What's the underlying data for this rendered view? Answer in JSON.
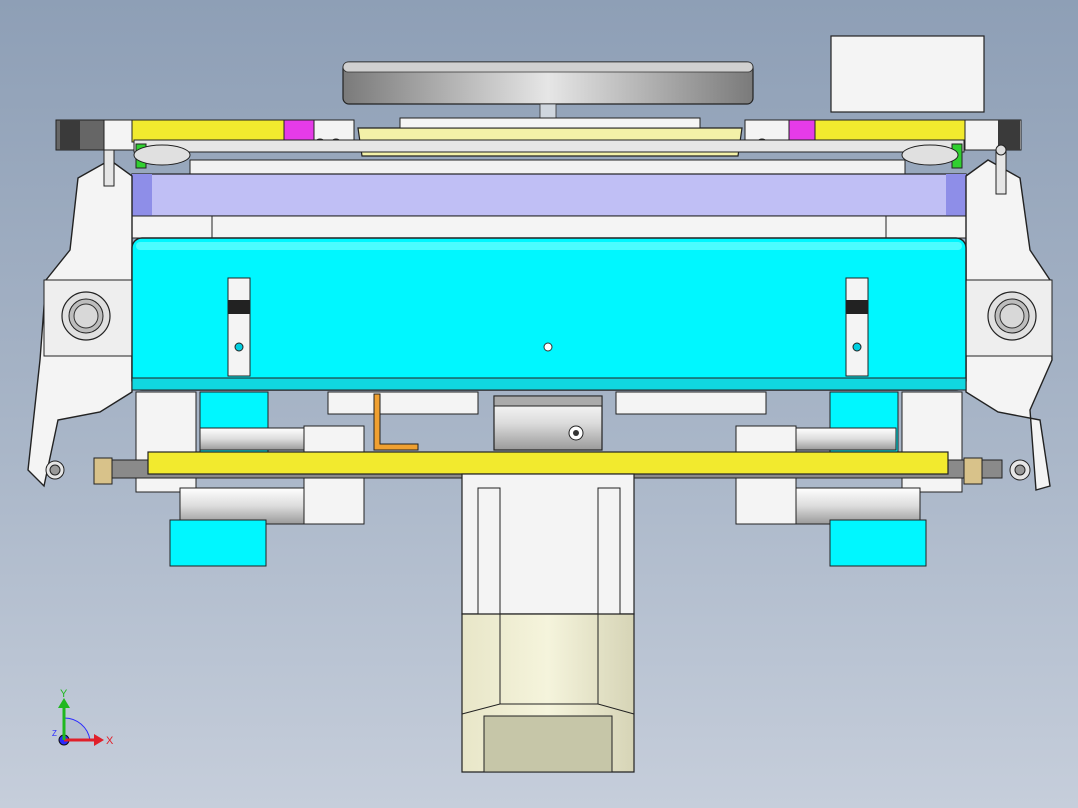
{
  "view": {
    "triad": {
      "x_label": "X",
      "y_label": "Y",
      "z_label": "Z",
      "x_color": "#e0202a",
      "y_color": "#1fb81f",
      "z_color": "#2a2aff"
    },
    "colors": {
      "background_top": "#8e9fb6",
      "background_bottom": "#c6cedb",
      "cyan_body": "#00f7ff",
      "lavender_plate": "#c0bff5",
      "yellow_rail": "#f2ea2e",
      "magenta_block": "#e53be8",
      "orange_bracket": "#f0a030",
      "green_accent": "#30d030",
      "white_frame": "#f4f4f4",
      "gray_disc": "#c9c9c9"
    }
  }
}
